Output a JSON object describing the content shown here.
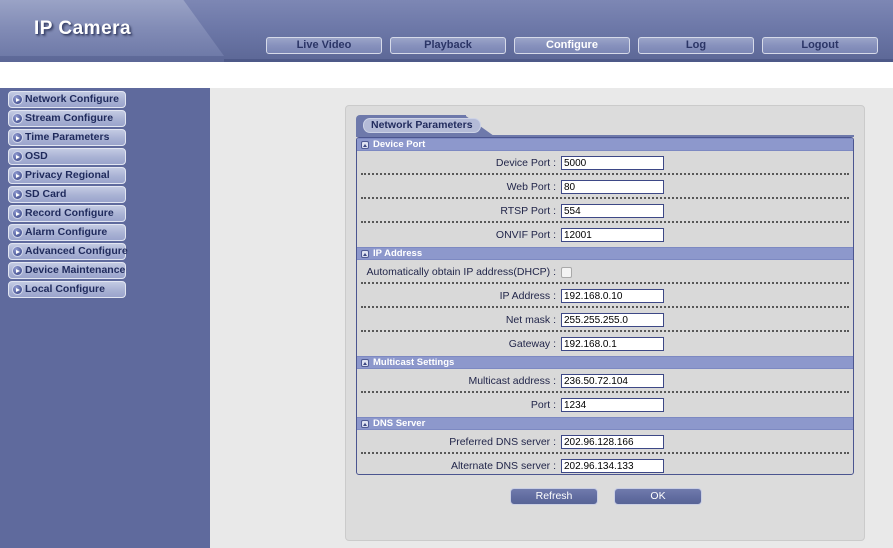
{
  "header": {
    "logo_title": "IP Camera",
    "nav": [
      {
        "label": "Live Video",
        "active": false
      },
      {
        "label": "Playback",
        "active": false
      },
      {
        "label": "Configure",
        "active": true
      },
      {
        "label": "Log",
        "active": false
      },
      {
        "label": "Logout",
        "active": false
      }
    ]
  },
  "sidebar": {
    "items": [
      {
        "label": "Network Configure",
        "icon": "arrow-circle-icon"
      },
      {
        "label": "Stream Configure",
        "icon": "arrow-circle-icon"
      },
      {
        "label": "Time Parameters",
        "icon": "arrow-circle-icon"
      },
      {
        "label": "OSD",
        "icon": "arrow-circle-icon"
      },
      {
        "label": "Privacy Regional",
        "icon": "arrow-circle-icon"
      },
      {
        "label": "SD Card",
        "icon": "arrow-circle-icon"
      },
      {
        "label": "Record Configure",
        "icon": "arrow-circle-icon"
      },
      {
        "label": "Alarm Configure",
        "icon": "arrow-circle-icon"
      },
      {
        "label": "Advanced Configure",
        "icon": "arrow-circle-icon"
      },
      {
        "label": "Device Maintenance",
        "icon": "arrow-circle-icon"
      },
      {
        "label": "Local Configure",
        "icon": "arrow-circle-icon"
      }
    ]
  },
  "main": {
    "tab_label": "Network Parameters",
    "sections": [
      {
        "title": "Device Port",
        "icon": "collapse-icon",
        "fields": [
          {
            "label": "Device Port :",
            "value": "5000",
            "type": "text"
          },
          {
            "label": "Web Port :",
            "value": "80",
            "type": "text"
          },
          {
            "label": "RTSP Port :",
            "value": "554",
            "type": "text"
          },
          {
            "label": "ONVIF Port :",
            "value": "12001",
            "type": "text"
          }
        ]
      },
      {
        "title": "IP Address",
        "icon": "collapse-icon",
        "fields": [
          {
            "label": "Automatically obtain IP address(DHCP) :",
            "value": "",
            "type": "checkbox",
            "checked": false
          },
          {
            "label": "IP Address :",
            "value": "192.168.0.10",
            "type": "text"
          },
          {
            "label": "Net mask :",
            "value": "255.255.255.0",
            "type": "text"
          },
          {
            "label": "Gateway :",
            "value": "192.168.0.1",
            "type": "text"
          }
        ]
      },
      {
        "title": "Multicast Settings",
        "icon": "collapse-icon",
        "fields": [
          {
            "label": "Multicast address :",
            "value": "236.50.72.104",
            "type": "text"
          },
          {
            "label": "Port :",
            "value": "1234",
            "type": "text"
          }
        ]
      },
      {
        "title": "DNS Server",
        "icon": "collapse-icon",
        "fields": [
          {
            "label": "Preferred DNS server :",
            "value": "202.96.128.166",
            "type": "text"
          },
          {
            "label": "Alternate DNS server :",
            "value": "202.96.134.133",
            "type": "text"
          }
        ]
      }
    ],
    "actions": [
      {
        "label": "Refresh"
      },
      {
        "label": "OK"
      }
    ]
  },
  "colors": {
    "header_blue": "#6d78a8",
    "sidebar_blue": "#5f6a9d",
    "section_header": "#8d98cc",
    "panel_gray": "#d9d9d9",
    "content_gray": "#e9e9e9",
    "input_border": "#3d4886"
  }
}
